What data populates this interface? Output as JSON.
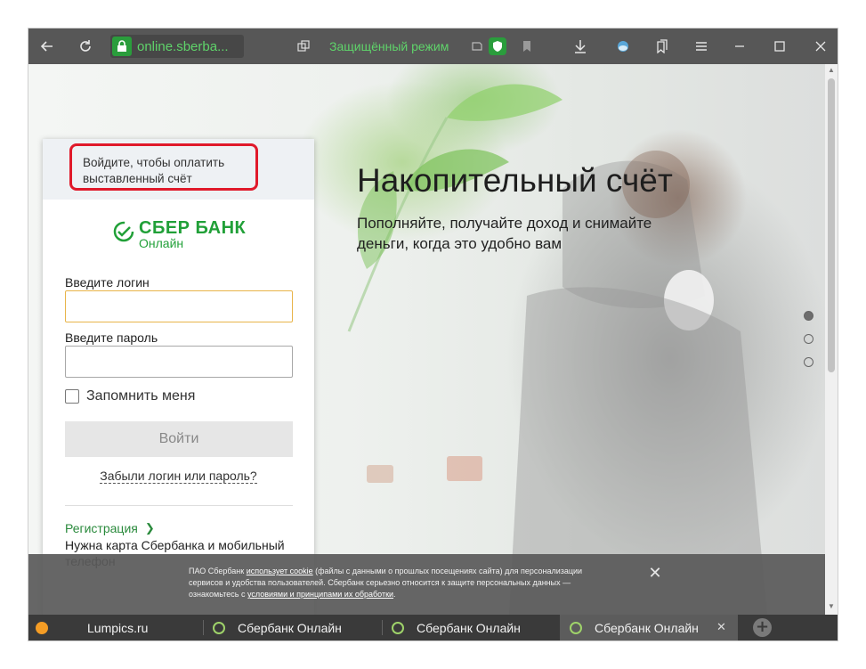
{
  "toolbar": {
    "url": "online.sberba...",
    "secure_mode": "Защищённый режим",
    "back_icon": "back-arrow-icon",
    "reload_icon": "reload-icon"
  },
  "hero": {
    "title": "Накопительный счёт",
    "subtitle": "Пополняйте, получайте доход и снимайте деньги, когда это удобно вам"
  },
  "login": {
    "notice": "Войдите, чтобы оплатить выставленный счёт",
    "logo_main": "СБЕР БАНК",
    "logo_sub": "Онлайн",
    "login_label": "Введите логин",
    "login_value": "",
    "password_label": "Введите пароль",
    "password_value": "",
    "remember_label": "Запомнить меня",
    "submit_label": "Войти",
    "forgot_label": "Забыли логин или пароль?",
    "register_label": "Регистрация",
    "need_card": "Нужна карта Сбербанка и мобильный телефон"
  },
  "cookie": {
    "text_1": "ПАО Сбербанк ",
    "link_1": "использует cookie",
    "text_2": " (файлы с данными о прошлых посещениях сайта) для персонализации сервисов и удобства пользователей. Сбербанк серьезно относится к защите персональных данных — ознакомьтесь с ",
    "link_2": "условиями и принципами их обработки",
    "text_3": "."
  },
  "tabs": [
    {
      "title": "Lumpics.ru"
    },
    {
      "title": "Сбербанк Онлайн"
    },
    {
      "title": "Сбербанк Онлайн"
    },
    {
      "title": "Сбербанк Онлайн"
    }
  ],
  "colors": {
    "sber_green": "#21a038",
    "highlight_red": "#e0192a",
    "toolbar_bg": "#575757"
  }
}
